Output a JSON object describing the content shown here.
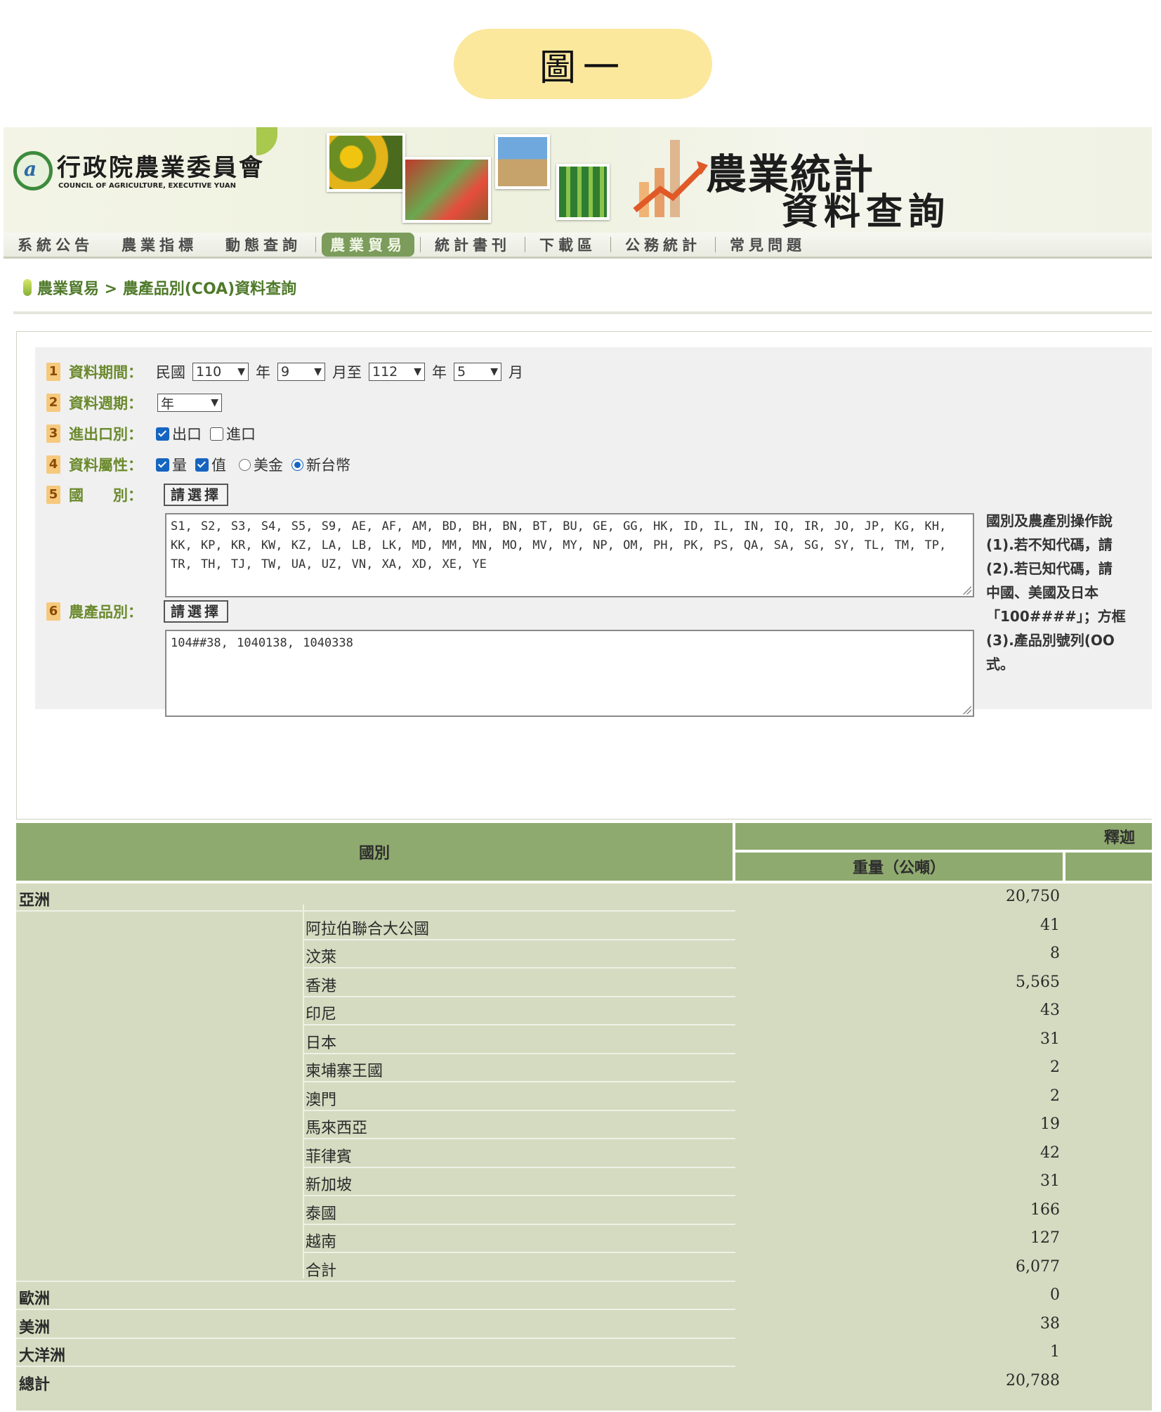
{
  "figure_label": "圖一",
  "header": {
    "org_name_cn": "行政院農業委員會",
    "org_name_en": "COUNCIL OF AGRICULTURE, EXECUTIVE YUAN",
    "title_line1": "農業統計",
    "title_line2": "資料查詢"
  },
  "nav": {
    "items": [
      {
        "label": "系統公告"
      },
      {
        "label": "農業指標"
      },
      {
        "label": "動態查詢"
      },
      {
        "label": "農業貿易",
        "active": true
      },
      {
        "label": "統計書刊"
      },
      {
        "label": "下載區"
      },
      {
        "label": "公務統計"
      },
      {
        "label": "常見問題"
      }
    ]
  },
  "breadcrumb": {
    "text": "農業貿易 > 農產品別(COA)資料查詢"
  },
  "form": {
    "period": {
      "num": "1",
      "label": "資料期間：",
      "prefix": "民國",
      "start_year": "110",
      "start_year_unit": "年",
      "start_month": "9",
      "start_month_unit": "月至",
      "end_year": "112",
      "end_year_unit": "年",
      "end_month": "5",
      "end_month_unit": "月"
    },
    "cycle": {
      "num": "2",
      "label": "資料週期：",
      "value": "年"
    },
    "direction": {
      "num": "3",
      "label": "進出口別：",
      "export_label": "出口",
      "export_checked": true,
      "import_label": "進口",
      "import_checked": false
    },
    "attribute": {
      "num": "4",
      "label": "資料屬性：",
      "qty_label": "量",
      "value_label": "值",
      "usd_label": "美金",
      "ntd_label": "新台幣",
      "currency_selected": "新台幣"
    },
    "country": {
      "num": "5",
      "label": "國　　別：",
      "button_label": "請選擇",
      "codes": "S1, S2, S3, S4, S5, S9, AE, AF, AM, BD, BH, BN, BT, BU, GE, GG, HK, ID, IL, IN, IQ, IR, JO, JP, KG, KH, KK, KP, KR, KW, KZ, LA, LB, LK, MD, MM, MN, MO, MV, MY, NP, OM, PH, PK, PS, QA, SA, SG, SY, TL, TM, TP, TR, TH, TJ, TW, UA, UZ, VN, XA, XD, XE, YE"
    },
    "product": {
      "num": "6",
      "label": "農產品別：",
      "button_label": "請選擇",
      "codes": "104##38, 1040138, 1040338"
    },
    "help": [
      "國別及農產別操作說",
      "(1).若不知代碼，請",
      "(2).若已知代碼，請",
      "中國、美國及日本",
      "「100####」；方框",
      "(3).產品別號列(OO",
      "式。"
    ]
  },
  "table": {
    "header_country": "國別",
    "header_group": "釋迦",
    "header_weight": "重量（公噸）",
    "rows": [
      {
        "region": "亞洲",
        "country": "",
        "value": "20,750",
        "line": "full"
      },
      {
        "region": "",
        "country": "阿拉伯聯合大公國",
        "value": "41",
        "line": "sub"
      },
      {
        "region": "",
        "country": "汶萊",
        "value": "8",
        "line": "sub"
      },
      {
        "region": "",
        "country": "香港",
        "value": "5,565",
        "line": "sub"
      },
      {
        "region": "",
        "country": "印尼",
        "value": "43",
        "line": "sub"
      },
      {
        "region": "",
        "country": "日本",
        "value": "31",
        "line": "sub"
      },
      {
        "region": "",
        "country": "柬埔寨王國",
        "value": "2",
        "line": "sub"
      },
      {
        "region": "",
        "country": "澳門",
        "value": "2",
        "line": "sub"
      },
      {
        "region": "",
        "country": "馬來西亞",
        "value": "19",
        "line": "sub"
      },
      {
        "region": "",
        "country": "菲律賓",
        "value": "42",
        "line": "sub"
      },
      {
        "region": "",
        "country": "新加坡",
        "value": "31",
        "line": "sub"
      },
      {
        "region": "",
        "country": "泰國",
        "value": "166",
        "line": "sub"
      },
      {
        "region": "",
        "country": "越南",
        "value": "127",
        "line": "sub"
      },
      {
        "region": "",
        "country": "合計",
        "value": "6,077",
        "line": "full"
      },
      {
        "region": "歐洲",
        "country": "",
        "value": "0",
        "line": "full"
      },
      {
        "region": "美洲",
        "country": "",
        "value": "38",
        "line": "full"
      },
      {
        "region": "大洋洲",
        "country": "",
        "value": "1",
        "line": "full"
      },
      {
        "region": "總計",
        "country": "",
        "value": "20,788",
        "line": "none"
      }
    ]
  }
}
